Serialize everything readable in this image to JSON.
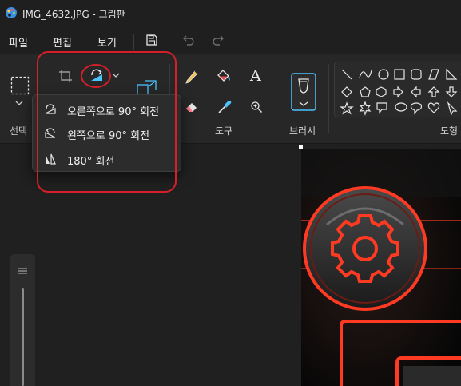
{
  "window": {
    "title": "IMG_4632.JPG - 그림판",
    "app_icon": "paint-palette-icon"
  },
  "menu": {
    "file": "파일",
    "edit": "편집",
    "view": "보기",
    "save_icon": "save-icon",
    "undo_icon": "undo-icon",
    "redo_icon": "redo-icon"
  },
  "ribbon": {
    "selection_label": "선택",
    "tools_label": "도구",
    "brushes_label": "브러시",
    "shapes_label": "도형",
    "text_icon_glyph": "A"
  },
  "rotate_menu": {
    "items": [
      {
        "label": "오른쪽으로 90° 회전",
        "icon": "rotate-right-icon"
      },
      {
        "label": "왼쪽으로 90° 회전",
        "icon": "rotate-left-icon"
      },
      {
        "label": "180° 회전",
        "icon": "rotate-180-icon"
      }
    ]
  },
  "colors": {
    "accent": "#4cc2ff",
    "annotation": "#d51f2a",
    "glow": "#ff3a22"
  }
}
